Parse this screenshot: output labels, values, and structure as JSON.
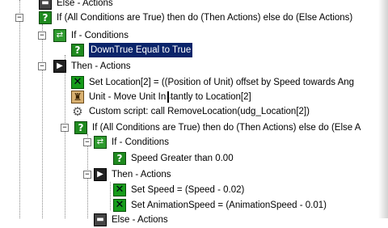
{
  "tree": {
    "else_actions_top": "Else - Actions",
    "if_then_else_1": "If (All Conditions are True) then do (Then Actions) else do (Else Actions)",
    "if_conditions_1": "If - Conditions",
    "condition_downtrue": "DownTrue Equal to True",
    "then_actions_1": "Then - Actions",
    "set_location": "Set Location[2] = ((Position of Unit) offset by Speed towards Ang",
    "unit_move": "Unit - Move Unit Instantly to Location[2]",
    "custom_script": "Custom script:   call RemoveLocation(udg_Location[2])",
    "if_then_else_2": "If (All Conditions are True) then do (Then Actions) else do (Else A",
    "if_conditions_2": "If - Conditions",
    "condition_speed": "Speed Greater than 0.00",
    "then_actions_2": "Then - Actions",
    "set_speed": "Set Speed = (Speed - 0.02)",
    "set_animspeed": "Set AnimationSpeed = (AnimationSpeed - 0.01)",
    "else_actions_bottom": "Else - Actions"
  },
  "icons": {
    "condition": "condition-icon",
    "if_conditions": "if-conditions-icon",
    "then_actions": "then-actions-icon",
    "else_actions": "else-actions-icon",
    "set_variable": "set-variable-icon",
    "unit_action": "unit-action-icon",
    "custom_script": "custom-script-icon"
  },
  "colors": {
    "selection": "#0a246a",
    "condition_green": "#1f8a1f",
    "set_green": "#169c1a"
  }
}
